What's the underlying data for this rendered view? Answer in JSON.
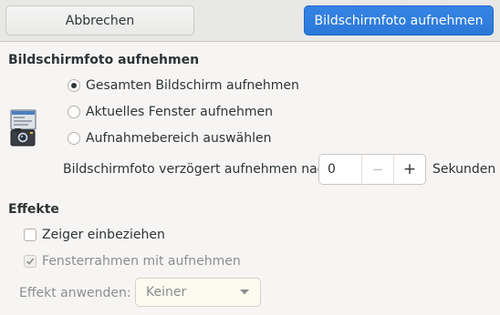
{
  "header": {
    "cancel_label": "Abbrechen",
    "take_label": "Bildschirmfoto aufnehmen"
  },
  "capture": {
    "title": "Bildschirmfoto aufnehmen",
    "icon": "screenshot-app-icon",
    "options": [
      {
        "label": "Gesamten Bildschirm aufnehmen",
        "selected": true
      },
      {
        "label": "Aktuelles Fenster aufnehmen",
        "selected": false
      },
      {
        "label": "Aufnahmebereich auswählen",
        "selected": false
      }
    ],
    "delay": {
      "label": "Bildschirmfoto verzögert aufnehmen nach",
      "value": "0",
      "minus": "−",
      "plus": "+",
      "unit": "Sekunden"
    }
  },
  "effects": {
    "title": "Effekte",
    "include_pointer": {
      "label": "Zeiger einbeziehen",
      "checked": false,
      "enabled": true
    },
    "include_border": {
      "label": "Fensterrahmen mit aufnehmen",
      "checked": true,
      "enabled": false
    },
    "apply_effect": {
      "label": "Effekt anwenden:",
      "value": "Keiner",
      "enabled": false
    }
  },
  "colors": {
    "accent": "#3584e4",
    "background": "#f6f5f4",
    "headerbar": "#e8e8e7"
  }
}
